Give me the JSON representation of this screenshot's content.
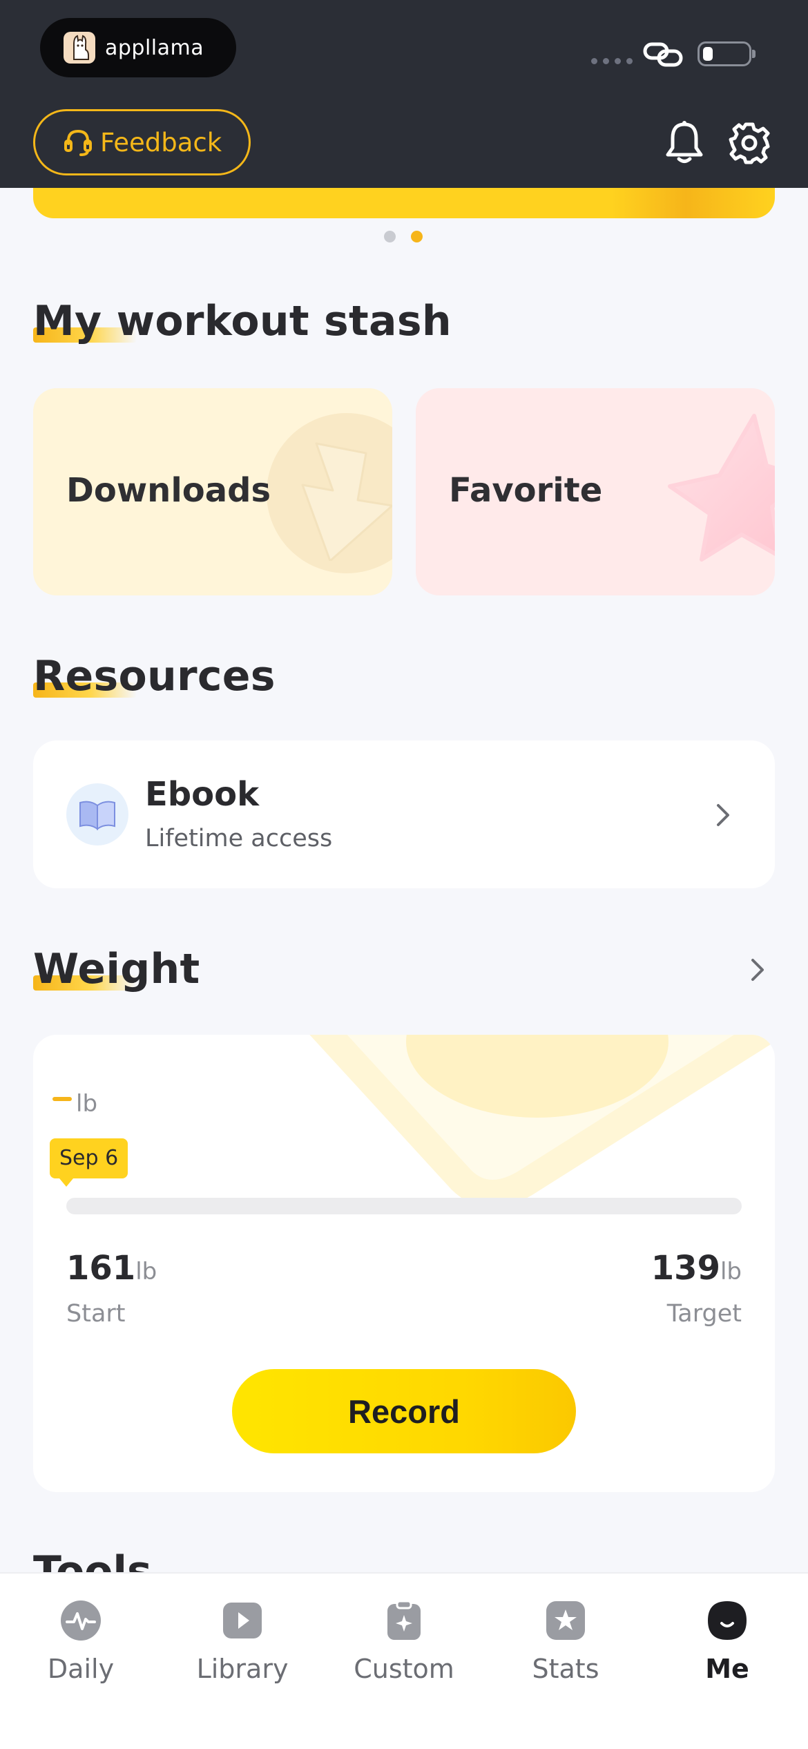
{
  "status_bar": {
    "app_badge": "appllama"
  },
  "header": {
    "feedback_label": "Feedback",
    "icons": [
      "bell-icon",
      "gear-icon"
    ]
  },
  "banner": {
    "pager_count": 2,
    "active_page": 2
  },
  "stash": {
    "title": "My workout stash",
    "cards": [
      {
        "label": "Downloads",
        "icon": "download-icon"
      },
      {
        "label": "Favorite",
        "icon": "star-icon"
      }
    ]
  },
  "resources": {
    "title": "Resources",
    "item": {
      "title": "Ebook",
      "subtitle": "Lifetime access",
      "icon": "book-icon"
    }
  },
  "weight": {
    "title": "Weight",
    "current_unit": "lb",
    "date_tag": "Sep 6",
    "progress_fraction": 0,
    "start": {
      "value": "161",
      "unit": "lb",
      "caption": "Start"
    },
    "target": {
      "value": "139",
      "unit": "lb",
      "caption": "Target"
    },
    "record_label": "Record"
  },
  "tools_peek": "Tools",
  "bottom_nav": [
    {
      "label": "Daily",
      "icon": "pulse-icon",
      "active": false
    },
    {
      "label": "Library",
      "icon": "play-icon",
      "active": false
    },
    {
      "label": "Custom",
      "icon": "clipboard-icon",
      "active": false
    },
    {
      "label": "Stats",
      "icon": "star-badge-icon",
      "active": false
    },
    {
      "label": "Me",
      "icon": "profile-icon",
      "active": true
    }
  ],
  "colors": {
    "accent": "#F6B51A",
    "brand_yellow": "#FFD21F",
    "header_bg": "#2B2E36",
    "page_bg": "#F6F7FB"
  }
}
